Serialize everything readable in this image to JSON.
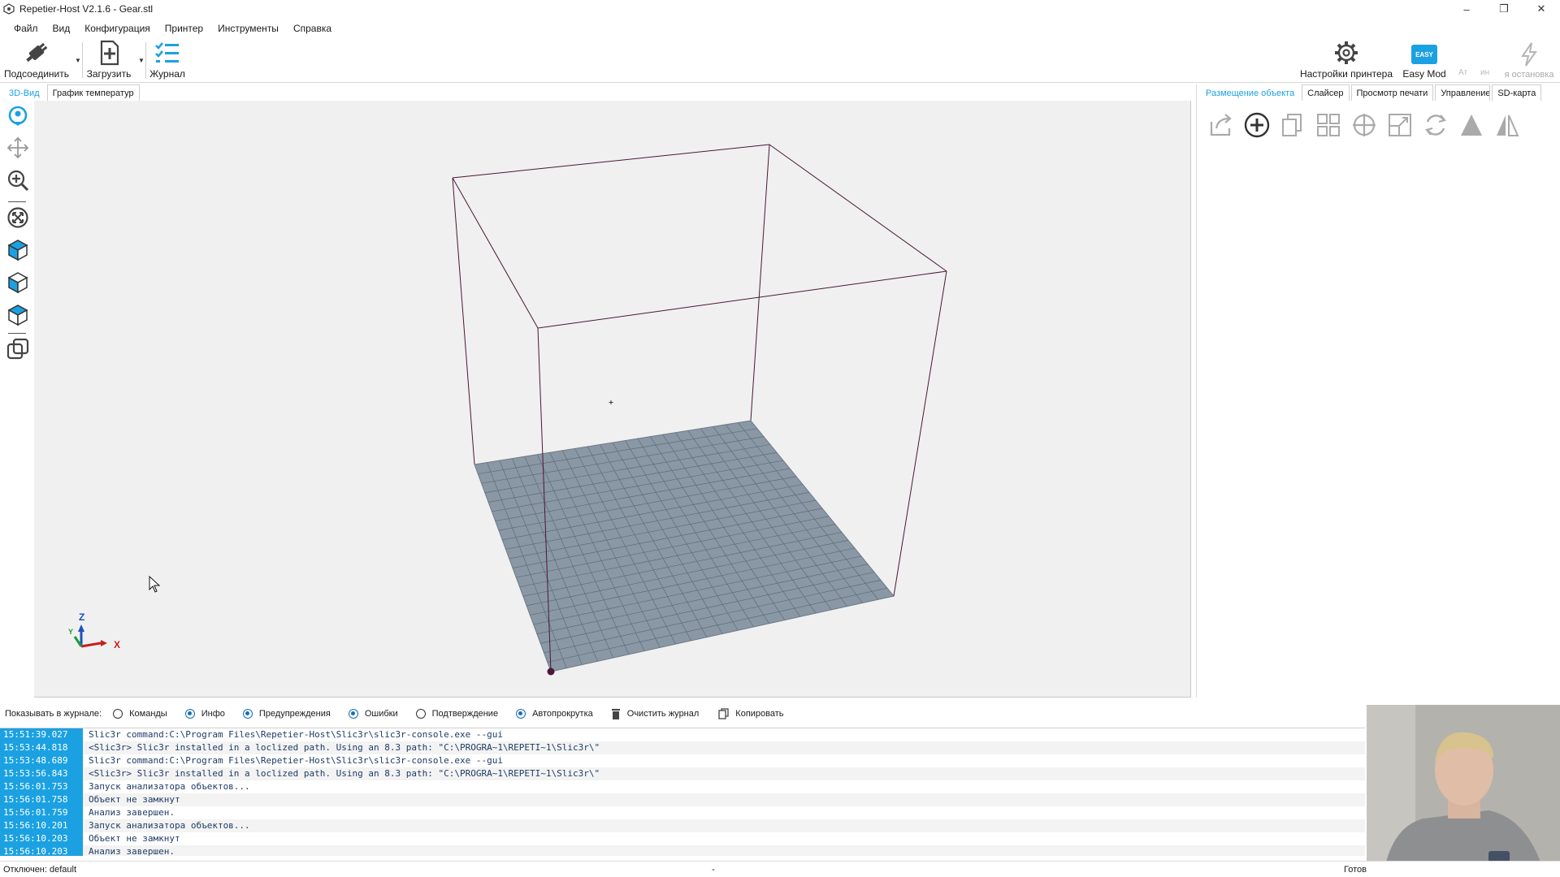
{
  "window": {
    "title": "Repetier-Host V2.1.6 - Gear.stl",
    "controls": [
      "–",
      "❐",
      "✕"
    ]
  },
  "menu": [
    "Файл",
    "Вид",
    "Конфигурация",
    "Принтер",
    "Инструменты",
    "Справка"
  ],
  "toolbar": {
    "connect_label": "Подсоединить",
    "load_label": "Загрузить",
    "log_label": "Журнал",
    "printer_settings_label": "Настройки принтера",
    "easy_mode_label": "Easy Mod",
    "easy_badge": "EASY",
    "emergency_label": "я остановка",
    "faded_a": "Ат",
    "faded_b": "ин"
  },
  "view_tabs": [
    "3D-Вид",
    "График температур"
  ],
  "right_tabs": [
    "Размещение объекта",
    "Слайсер",
    "Просмотр печати",
    "Управление",
    "SD-карта"
  ],
  "axis": {
    "z": "Z",
    "x": "X",
    "y": "Y"
  },
  "log_filters": {
    "label": "Показывать в журнале:",
    "options": [
      {
        "label": "Команды",
        "checked": false
      },
      {
        "label": "Инфо",
        "checked": true
      },
      {
        "label": "Предупреждения",
        "checked": true
      },
      {
        "label": "Ошибки",
        "checked": true
      },
      {
        "label": "Подтверждение",
        "checked": false
      },
      {
        "label": "Автопрокрутка",
        "checked": true
      }
    ],
    "clear_label": "Очистить журнал",
    "copy_label": "Копировать"
  },
  "log": [
    {
      "time": "15:51:39.027",
      "msg": "Slic3r command:C:\\Program Files\\Repetier-Host\\Slic3r\\slic3r-console.exe --gui"
    },
    {
      "time": "15:53:44.818",
      "msg": "<Slic3r> Slic3r installed in a loclized path. Using an 8.3 path: \"C:\\PROGRA~1\\REPETI~1\\Slic3r\\\""
    },
    {
      "time": "15:53:48.689",
      "msg": "Slic3r command:C:\\Program Files\\Repetier-Host\\Slic3r\\slic3r-console.exe --gui"
    },
    {
      "time": "15:53:56.843",
      "msg": "<Slic3r> Slic3r installed in a loclized path. Using an 8.3 path: \"C:\\PROGRA~1\\REPETI~1\\Slic3r\\\""
    },
    {
      "time": "15:56:01.753",
      "msg": "Запуск анализатора объектов..."
    },
    {
      "time": "15:56:01.758",
      "msg": "Объект не замкнут"
    },
    {
      "time": "15:56:01.759",
      "msg": "Анализ завершен."
    },
    {
      "time": "15:56:10.201",
      "msg": "Запуск анализатора объектов..."
    },
    {
      "time": "15:56:10.203",
      "msg": "Объект не замкнут"
    },
    {
      "time": "15:56:10.203",
      "msg": "Анализ завершен."
    }
  ],
  "status": {
    "connection": "Отключен: default",
    "middle": "-",
    "right": "Готов"
  },
  "colors": {
    "accent": "#1ba1e2",
    "plate": "#8a98a5",
    "cage": "#4a1838"
  }
}
